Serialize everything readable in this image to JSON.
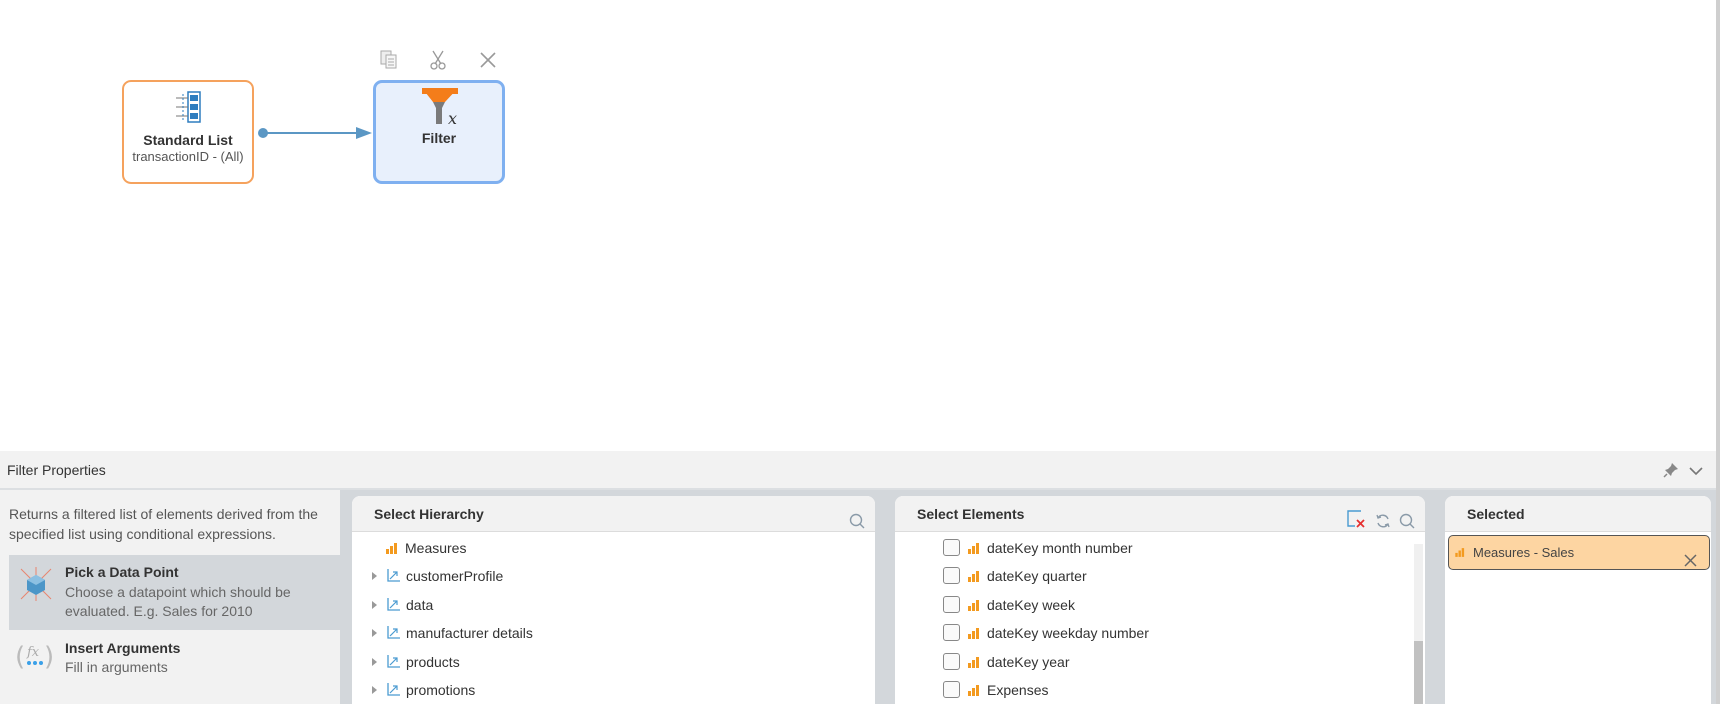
{
  "canvas": {
    "toolbar": {
      "copy_icon": "copy-icon",
      "cut_icon": "scissors-icon",
      "delete_icon": "close-icon"
    },
    "nodes": [
      {
        "title": "Standard List",
        "subtitle": "transactionID - (All)",
        "icon": "list-icon",
        "border": "#f5a25d"
      },
      {
        "title": "Filter",
        "icon": "filter-icon",
        "border": "#7fb0f0",
        "fill": "#e8f0fc",
        "selected": true
      }
    ]
  },
  "properties": {
    "title": "Filter Properties",
    "description": "Returns a filtered list of elements derived from the specified list using conditional expressions.",
    "actions": [
      {
        "title": "Pick a Data Point",
        "desc": "Choose a datapoint which should be evaluated. E.g. Sales for 2010",
        "active": true
      },
      {
        "title": "Insert Arguments",
        "desc": "Fill in arguments"
      }
    ],
    "hierarchy": {
      "title": "Select Hierarchy",
      "items": [
        "Measures",
        "customerProfile",
        "data",
        "manufacturer details",
        "products",
        "promotions"
      ]
    },
    "elements": {
      "title": "Select Elements",
      "items": [
        "dateKey month number",
        "dateKey quarter",
        "dateKey week",
        "dateKey weekday number",
        "dateKey year",
        "Expenses"
      ]
    },
    "selected": {
      "title": "Selected",
      "items": [
        "Measures - Sales"
      ]
    }
  },
  "colors": {
    "accent": "#f39a1f",
    "chip": "#fdd5a2",
    "node_selected": "#7fb0f0"
  }
}
